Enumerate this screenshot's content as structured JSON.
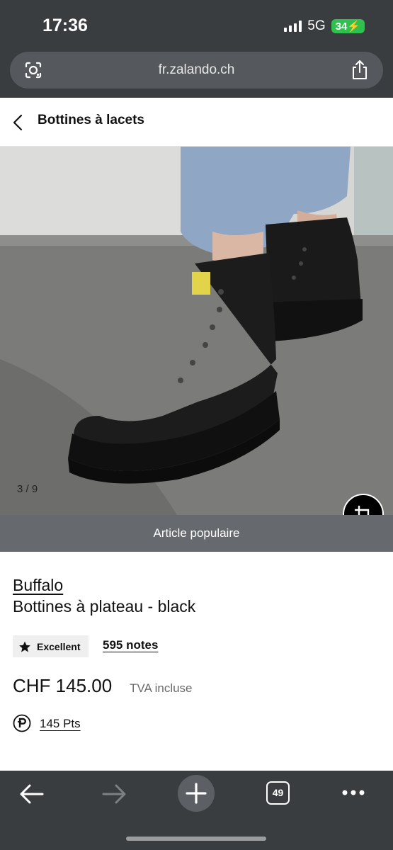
{
  "status_bar": {
    "time": "17:36",
    "network": "5G",
    "battery": "34"
  },
  "browser": {
    "url": "fr.zalando.ch",
    "tab_count": "49"
  },
  "header": {
    "title": "Bottines à lacets"
  },
  "gallery": {
    "counter": "3 / 9",
    "banner": "Article populaire"
  },
  "product": {
    "brand": "Buffalo",
    "name": "Bottines à plateau - black",
    "rating_label": "Excellent",
    "reviews": "595 notes",
    "price": "CHF 145.00",
    "vat_note": "TVA incluse",
    "points": "145 Pts"
  },
  "icons": {
    "lens": "lens-icon",
    "share": "share-icon",
    "back": "chevron-left-icon",
    "crop": "crop-icon",
    "star": "star-icon",
    "points": "points-p-icon",
    "nav_back": "arrow-left-icon",
    "nav_forward": "arrow-right-icon",
    "new_tab": "plus-icon",
    "more": "more-dots-icon"
  },
  "colors": {
    "chrome": "#3a3d40",
    "battery": "#30c04f",
    "banner": "#66696d"
  }
}
